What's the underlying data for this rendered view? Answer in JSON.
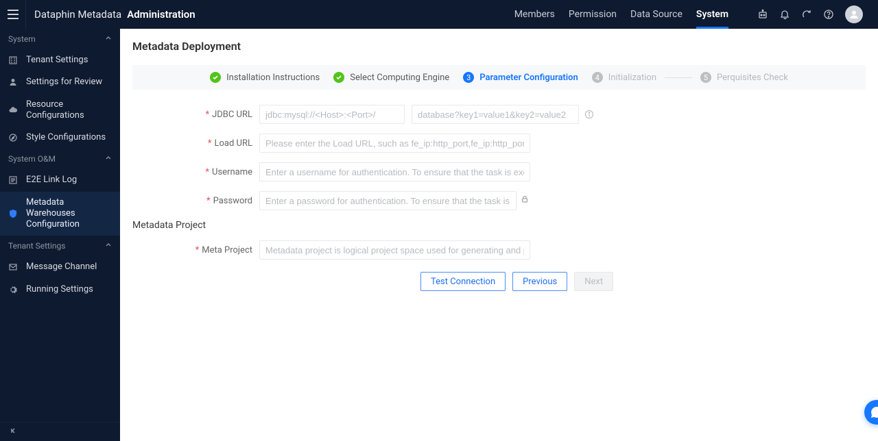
{
  "header": {
    "app_prefix": "Dataphin Metadata",
    "app_section": "Administration",
    "nav": {
      "members": "Members",
      "permission": "Permission",
      "data_source": "Data Source",
      "system": "System"
    }
  },
  "sidebar": {
    "groups": {
      "system": "System",
      "system_om": "System O&M",
      "tenant_settings": "Tenant Settings"
    },
    "items": {
      "tenant_settings": "Tenant Settings",
      "settings_for_review": "Settings for Review",
      "resource_configurations": "Resource Configurations",
      "style_configurations": "Style Configurations",
      "e2e_link_log": "E2E Link Log",
      "metadata_warehouses_configuration": "Metadata Warehouses Configuration",
      "message_channel": "Message Channel",
      "running_settings": "Running Settings"
    }
  },
  "main": {
    "page_title": "Metadata Deployment",
    "steps": {
      "s1": "Installation Instructions",
      "s2": "Select Computing Engine",
      "s3": "Parameter Configuration",
      "s4": "Initialization",
      "s5": "Perquisites Check"
    },
    "form": {
      "jdbc_url_label": "JDBC URL",
      "jdbc_url_placeholder1": "jdbc:mysql://<Host>:<Port>/",
      "jdbc_url_placeholder2": "database?key1=value1&key2=value2",
      "load_url_label": "Load URL",
      "load_url_placeholder": "Please enter the Load URL, such as fe_ip:http_port,fe_ip:http_port",
      "username_label": "Username",
      "username_placeholder": "Enter a username for authentication. To ensure that the task is executed nor…",
      "password_label": "Password",
      "password_placeholder": "Enter a password for authentication. To ensure that the task is executed …",
      "section_metadata_project": "Metadata Project",
      "meta_project_label": "Meta Project",
      "meta_project_placeholder": "Metadata project is logical project space used for generating and process me…"
    },
    "buttons": {
      "test_connection": "Test Connection",
      "previous": "Previous",
      "next": "Next"
    },
    "badges": {
      "s3": "3",
      "s4": "4",
      "s5": "5"
    }
  }
}
